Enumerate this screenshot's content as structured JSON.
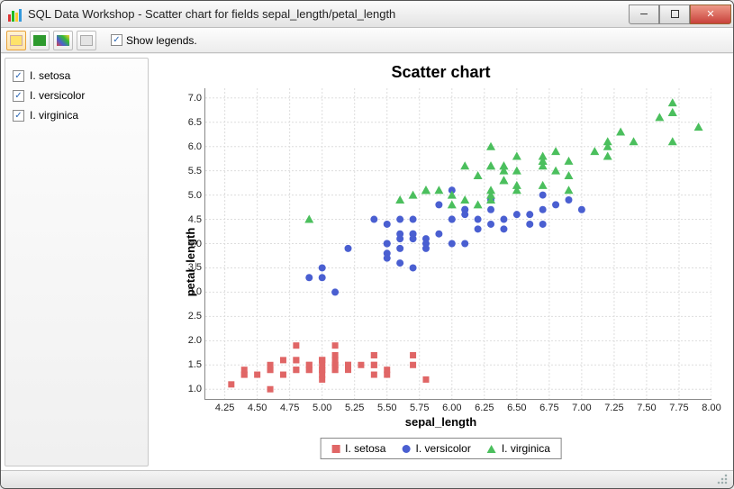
{
  "window": {
    "title": "SQL Data Workshop - Scatter chart for fields sepal_length/petal_length"
  },
  "toolbar": {
    "show_legends_label": "Show legends.",
    "buttons": [
      {
        "name": "btn-palette-yellow",
        "color": "#ffe36b"
      },
      {
        "name": "btn-palette-green",
        "color": "#2e9a2e"
      },
      {
        "name": "btn-palette-multi",
        "color": "multi"
      },
      {
        "name": "btn-palette-gray",
        "color": "#d9d9d9"
      }
    ]
  },
  "sidebar": {
    "items": [
      {
        "label": "I. setosa",
        "checked": true
      },
      {
        "label": "I. versicolor",
        "checked": true
      },
      {
        "label": "I. virginica",
        "checked": true
      }
    ]
  },
  "legend": {
    "items": [
      {
        "label": "I. setosa",
        "marker": "square",
        "color": "#e06666"
      },
      {
        "label": "I. versicolor",
        "marker": "circle",
        "color": "#4a5fd1"
      },
      {
        "label": "I. virginica",
        "marker": "triangle",
        "color": "#4bbf5d"
      }
    ]
  },
  "chart_data": {
    "type": "scatter",
    "title": "Scatter chart",
    "xlabel": "sepal_length",
    "ylabel": "petal_length",
    "xlim": [
      4.1,
      8.0
    ],
    "ylim": [
      0.8,
      7.2
    ],
    "xticks": [
      4.25,
      4.5,
      4.75,
      5.0,
      5.25,
      5.5,
      5.75,
      6.0,
      6.25,
      6.5,
      6.75,
      7.0,
      7.25,
      7.5,
      7.75,
      8.0
    ],
    "yticks": [
      1.0,
      1.5,
      2.0,
      2.5,
      3.0,
      3.5,
      4.0,
      4.5,
      5.0,
      5.5,
      6.0,
      6.5,
      7.0
    ],
    "series": [
      {
        "name": "I. setosa",
        "marker": "square",
        "color": "#e06666",
        "points": [
          [
            5.1,
            1.4
          ],
          [
            4.9,
            1.4
          ],
          [
            4.7,
            1.3
          ],
          [
            4.6,
            1.5
          ],
          [
            5.0,
            1.4
          ],
          [
            5.4,
            1.7
          ],
          [
            4.6,
            1.4
          ],
          [
            5.0,
            1.5
          ],
          [
            4.4,
            1.4
          ],
          [
            4.9,
            1.5
          ],
          [
            5.4,
            1.5
          ],
          [
            4.8,
            1.6
          ],
          [
            4.8,
            1.4
          ],
          [
            4.3,
            1.1
          ],
          [
            5.8,
            1.2
          ],
          [
            5.7,
            1.5
          ],
          [
            5.4,
            1.3
          ],
          [
            5.1,
            1.4
          ],
          [
            5.7,
            1.7
          ],
          [
            5.1,
            1.5
          ],
          [
            5.4,
            1.7
          ],
          [
            5.1,
            1.5
          ],
          [
            4.6,
            1.0
          ],
          [
            5.1,
            1.7
          ],
          [
            4.8,
            1.9
          ],
          [
            5.0,
            1.6
          ],
          [
            5.0,
            1.6
          ],
          [
            5.2,
            1.5
          ],
          [
            5.2,
            1.4
          ],
          [
            4.7,
            1.6
          ],
          [
            4.8,
            1.6
          ],
          [
            5.4,
            1.5
          ],
          [
            5.2,
            1.5
          ],
          [
            5.5,
            1.4
          ],
          [
            4.9,
            1.5
          ],
          [
            5.0,
            1.2
          ],
          [
            5.5,
            1.3
          ],
          [
            4.9,
            1.4
          ],
          [
            4.4,
            1.3
          ],
          [
            5.1,
            1.5
          ],
          [
            5.0,
            1.3
          ],
          [
            4.5,
            1.3
          ],
          [
            4.4,
            1.3
          ],
          [
            5.0,
            1.6
          ],
          [
            5.1,
            1.9
          ],
          [
            4.8,
            1.4
          ],
          [
            5.1,
            1.6
          ],
          [
            4.6,
            1.4
          ],
          [
            5.3,
            1.5
          ],
          [
            5.0,
            1.4
          ]
        ]
      },
      {
        "name": "I. versicolor",
        "marker": "circle",
        "color": "#4a5fd1",
        "points": [
          [
            7.0,
            4.7
          ],
          [
            6.4,
            4.5
          ],
          [
            6.9,
            4.9
          ],
          [
            5.5,
            4.0
          ],
          [
            6.5,
            4.6
          ],
          [
            5.7,
            4.5
          ],
          [
            6.3,
            4.7
          ],
          [
            4.9,
            3.3
          ],
          [
            6.6,
            4.6
          ],
          [
            5.2,
            3.9
          ],
          [
            5.0,
            3.5
          ],
          [
            5.9,
            4.2
          ],
          [
            6.0,
            4.0
          ],
          [
            6.1,
            4.7
          ],
          [
            5.6,
            3.6
          ],
          [
            6.7,
            4.4
          ],
          [
            5.6,
            4.5
          ],
          [
            5.8,
            4.1
          ],
          [
            6.2,
            4.5
          ],
          [
            5.6,
            3.9
          ],
          [
            5.9,
            4.8
          ],
          [
            6.1,
            4.0
          ],
          [
            6.3,
            4.9
          ],
          [
            6.1,
            4.7
          ],
          [
            6.4,
            4.3
          ],
          [
            6.6,
            4.4
          ],
          [
            6.8,
            4.8
          ],
          [
            6.7,
            5.0
          ],
          [
            6.0,
            4.5
          ],
          [
            5.7,
            3.5
          ],
          [
            5.5,
            3.8
          ],
          [
            5.5,
            3.7
          ],
          [
            5.8,
            3.9
          ],
          [
            6.0,
            5.1
          ],
          [
            5.4,
            4.5
          ],
          [
            6.0,
            4.5
          ],
          [
            6.7,
            4.7
          ],
          [
            6.3,
            4.4
          ],
          [
            5.6,
            4.1
          ],
          [
            5.5,
            4.0
          ],
          [
            5.5,
            4.4
          ],
          [
            6.1,
            4.6
          ],
          [
            5.8,
            4.0
          ],
          [
            5.0,
            3.3
          ],
          [
            5.6,
            4.2
          ],
          [
            5.7,
            4.2
          ],
          [
            5.7,
            4.2
          ],
          [
            6.2,
            4.3
          ],
          [
            5.1,
            3.0
          ],
          [
            5.7,
            4.1
          ]
        ]
      },
      {
        "name": "I. virginica",
        "marker": "triangle",
        "color": "#4bbf5d",
        "points": [
          [
            6.3,
            6.0
          ],
          [
            5.8,
            5.1
          ],
          [
            7.1,
            5.9
          ],
          [
            6.3,
            5.6
          ],
          [
            6.5,
            5.8
          ],
          [
            7.6,
            6.6
          ],
          [
            4.9,
            4.5
          ],
          [
            7.3,
            6.3
          ],
          [
            6.7,
            5.8
          ],
          [
            7.2,
            6.1
          ],
          [
            6.5,
            5.1
          ],
          [
            6.4,
            5.3
          ],
          [
            6.8,
            5.5
          ],
          [
            5.7,
            5.0
          ],
          [
            5.8,
            5.1
          ],
          [
            6.4,
            5.3
          ],
          [
            6.5,
            5.5
          ],
          [
            7.7,
            6.7
          ],
          [
            7.7,
            6.9
          ],
          [
            6.0,
            5.0
          ],
          [
            6.9,
            5.7
          ],
          [
            5.6,
            4.9
          ],
          [
            7.7,
            6.7
          ],
          [
            6.3,
            4.9
          ],
          [
            6.7,
            5.7
          ],
          [
            7.2,
            6.0
          ],
          [
            6.2,
            4.8
          ],
          [
            6.1,
            4.9
          ],
          [
            6.4,
            5.6
          ],
          [
            7.2,
            5.8
          ],
          [
            7.4,
            6.1
          ],
          [
            7.9,
            6.4
          ],
          [
            6.4,
            5.6
          ],
          [
            6.3,
            5.1
          ],
          [
            6.1,
            5.6
          ],
          [
            7.7,
            6.1
          ],
          [
            6.3,
            5.6
          ],
          [
            6.4,
            5.5
          ],
          [
            6.0,
            4.8
          ],
          [
            6.9,
            5.4
          ],
          [
            6.7,
            5.6
          ],
          [
            6.9,
            5.1
          ],
          [
            5.8,
            5.1
          ],
          [
            6.8,
            5.9
          ],
          [
            6.7,
            5.7
          ],
          [
            6.7,
            5.2
          ],
          [
            6.3,
            5.0
          ],
          [
            6.5,
            5.2
          ],
          [
            6.2,
            5.4
          ],
          [
            5.9,
            5.1
          ]
        ]
      }
    ]
  }
}
